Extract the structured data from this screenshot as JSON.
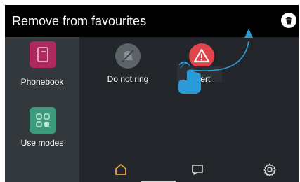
{
  "header": {
    "title": "Remove from favourites",
    "trash_icon": "trash-icon"
  },
  "sidebar": {
    "items": [
      {
        "label": "Phonebook",
        "icon": "phonebook-icon",
        "color": "#b02860"
      },
      {
        "label": "Use modes",
        "icon": "use-modes-icon",
        "color": "#3e9a7c"
      }
    ]
  },
  "favourites": [
    {
      "label": "Do not ring",
      "icon": "do-not-ring-icon",
      "color": "#5d6468"
    },
    {
      "label": "Alert",
      "icon": "alert-icon",
      "color": "#e0454a"
    }
  ],
  "bottom_nav": {
    "items": [
      {
        "icon": "home-icon",
        "active_color": "#e8a33b"
      },
      {
        "icon": "chat-icon"
      },
      {
        "icon": "settings-icon"
      }
    ]
  },
  "gesture": {
    "hand_icon": "hand-pointer-icon",
    "arrow_color": "#2a9bd8"
  }
}
